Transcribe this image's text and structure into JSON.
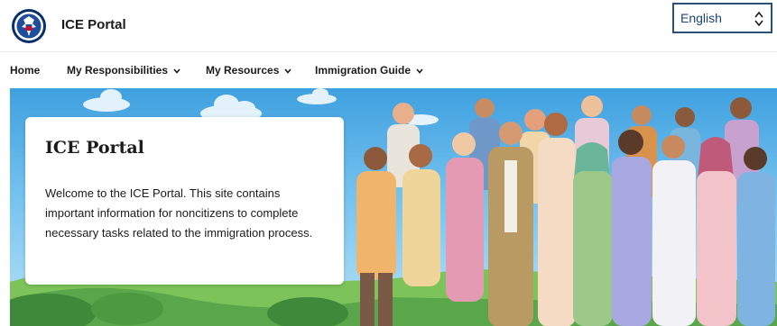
{
  "header": {
    "site_title": "ICE Portal",
    "seal_icon": "dhs-seal-icon",
    "language": {
      "selected": "English",
      "options": [
        "English"
      ]
    }
  },
  "nav": {
    "items": [
      {
        "label": "Home",
        "dropdown": false
      },
      {
        "label": "My Responsibilities",
        "dropdown": true
      },
      {
        "label": "My Resources",
        "dropdown": true
      },
      {
        "label": "Immigration Guide",
        "dropdown": true
      }
    ]
  },
  "hero": {
    "title": "ICE Portal",
    "body": "Welcome to the ICE Portal. This site contains important information for noncitizens to complete necessary tasks related to the immigration process."
  },
  "colors": {
    "select_border": "#2a4f7a",
    "select_text": "#1a4480",
    "sky_top": "#3fa0df",
    "sky_bottom": "#b9e3f6",
    "grass": "#5aa64a"
  }
}
